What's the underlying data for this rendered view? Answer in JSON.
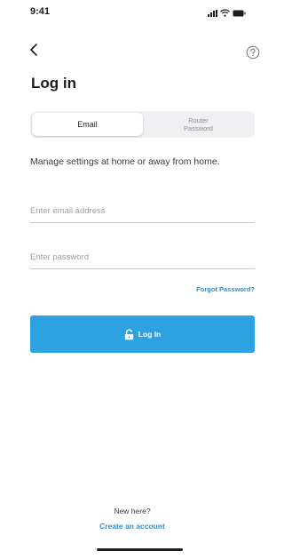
{
  "status_bar": {
    "time": "9:41",
    "icons": [
      "signal-icon",
      "wifi-icon",
      "battery-icon"
    ]
  },
  "nav": {
    "back_icon": "chevron-left-icon",
    "help_icon": "help-circle-icon"
  },
  "page": {
    "title": "Log in"
  },
  "tabs": {
    "items": [
      {
        "label": "Email",
        "selected": true
      },
      {
        "label": "Router\nPassword",
        "selected": false
      }
    ]
  },
  "form": {
    "description": "Manage settings at home or away from home.",
    "email": {
      "placeholder": "Enter email address",
      "value": ""
    },
    "password": {
      "placeholder": "Enter password",
      "value": ""
    },
    "forgot_label": "Forgot Password?",
    "login_label": "Log In",
    "login_icon": "unlock-icon"
  },
  "footer": {
    "prompt": "New here?",
    "create_label": "Create an account"
  },
  "colors": {
    "accent": "#2ea1e1",
    "link": "#2b8fd6",
    "text": "#1c1c1e",
    "muted": "#8e8e93",
    "segment_bg": "#f0f0f2"
  }
}
